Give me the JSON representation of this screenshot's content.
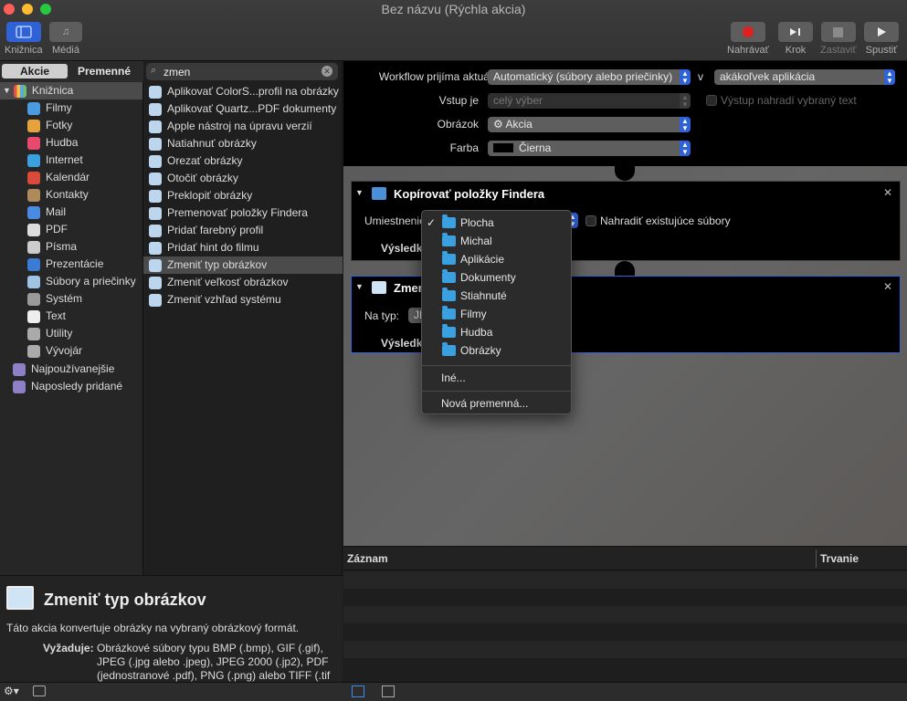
{
  "window": {
    "title": "Bez názvu (Rýchla akcia)"
  },
  "toolbar": {
    "library": "Knižnica",
    "media": "Médiá",
    "record": "Nahrávať",
    "step": "Krok",
    "stop": "Zastaviť",
    "run": "Spustiť"
  },
  "tabs": {
    "actions": "Akcie",
    "variables": "Premenné"
  },
  "search": {
    "value": "zmen"
  },
  "library": {
    "root": "Knižnica",
    "items": [
      "Filmy",
      "Fotky",
      "Hudba",
      "Internet",
      "Kalendár",
      "Kontakty",
      "Mail",
      "PDF",
      "Písma",
      "Prezentácie",
      "Súbory a priečinky",
      "Systém",
      "Text",
      "Utility",
      "Vývojár"
    ],
    "smart": [
      "Najpoužívanejšie",
      "Naposledy pridané"
    ]
  },
  "actions": {
    "items": [
      "Aplikovať ColorS...profil na obrázky",
      "Aplikovať Quartz...PDF dokumenty",
      "Apple nástroj na úpravu verzií",
      "Natiahnuť obrázky",
      "Orezať obrázky",
      "Otočiť obrázky",
      "Preklopiť obrázky",
      "Premenovať položky Findera",
      "Pridať farebný profil",
      "Pridať hint do filmu",
      "Zmeniť typ obrázkov",
      "Zmeniť veľkosť obrázkov",
      "Zmeniť vzhľad systému"
    ],
    "selected_index": 10
  },
  "description": {
    "title": "Zmeniť typ obrázkov",
    "text": "Táto akcia konvertuje obrázky na vybraný obrázkový formát.",
    "requires_label": "Vyžaduje:",
    "requires_lines": [
      "Obrázkové súbory typu BMP (.bmp), GIF (.gif),",
      "JPEG (.jpg alebo .jpeg), JPEG 2000 (.jp2), PDF",
      "(jednostranové .pdf), PNG (.png) alebo TIFF (.tif"
    ]
  },
  "workflow": {
    "receives_label": "Workflow prijíma aktuálne",
    "receives_value": "Automatický (súbory alebo priečinky)",
    "in_label": "v",
    "app_value": "akákoľvek aplikácia",
    "input_label": "Vstup je",
    "input_value": "celý výber",
    "replace_output": "Výstup nahradí vybraný text",
    "image_label": "Obrázok",
    "image_value": "Akcia",
    "color_label": "Farba",
    "color_value": "Čierna"
  },
  "card1": {
    "title": "Kopírovať položky Findera",
    "location_label": "Umiestnenie",
    "replace_label": "Nahradiť existujúce súbory",
    "results_label": "Výsledky"
  },
  "card2": {
    "title": "Zmeniť typ obrázkov",
    "to_type_label": "Na typ:",
    "to_type_value": "JPEG",
    "results_label": "Výsledky"
  },
  "menu": {
    "items": [
      "Plocha",
      "Michal",
      "Aplikácie",
      "Dokumenty",
      "Stiahnuté",
      "Filmy",
      "Hudba",
      "Obrázky"
    ],
    "checked_index": 0,
    "other": "Iné...",
    "new_variable": "Nová premenná..."
  },
  "log": {
    "col_log": "Záznam",
    "col_duration": "Trvanie"
  },
  "colors": {
    "accent": "#2f62d6",
    "selection": "#4b4b4b"
  }
}
